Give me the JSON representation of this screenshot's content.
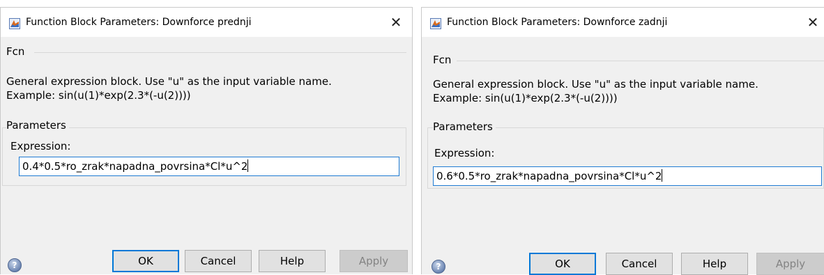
{
  "left_dialog": {
    "title": "Function Block Parameters: Downforce prednji",
    "close_glyph": "✕",
    "block_type": "Fcn",
    "description_line1": "General expression block. Use \"u\" as the input variable name.",
    "description_line2": "Example: sin(u(1)*exp(2.3*(-u(2))))",
    "parameters_title": "Parameters",
    "expression_label": "Expression:",
    "expression_value": "0.4*0.5*ro_zrak*napadna_povrsina*Cl*u^2",
    "help_glyph": "?",
    "ok_label": "OK",
    "cancel_label": "Cancel",
    "help_label": "Help",
    "apply_label": "Apply"
  },
  "right_dialog": {
    "title": "Function Block Parameters: Downforce zadnji",
    "close_glyph": "✕",
    "block_type": "Fcn",
    "description_line1": "General expression block. Use \"u\" as the input variable name.",
    "description_line2": "Example: sin(u(1)*exp(2.3*(-u(2))))",
    "parameters_title": "Parameters",
    "expression_label": "Expression:",
    "expression_value": "0.6*0.5*ro_zrak*napadna_povrsina*Cl*u^2",
    "help_glyph": "?",
    "ok_label": "OK",
    "cancel_label": "Cancel",
    "help_label": "Help",
    "apply_label": "Apply"
  },
  "colors": {
    "dialog_bg": "#f0f0f0",
    "titlebar_bg": "#ffffff",
    "focus_border": "#1f7bd3",
    "default_button_border": "#0078d7",
    "disabled_text": "#838383"
  },
  "icons": {
    "title_icon": "simulink-block-icon",
    "close": "close-icon",
    "help": "help-icon"
  }
}
